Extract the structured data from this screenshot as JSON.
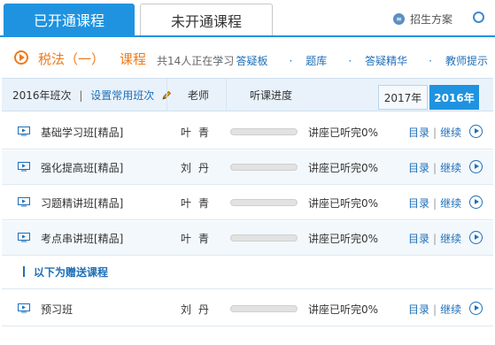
{
  "tabs": {
    "active": "已开通课程",
    "inactive": "未开通课程"
  },
  "top_right": {
    "recruit_label": "招生方案"
  },
  "course": {
    "name": "税法（一）",
    "word": "课程",
    "learners": "共14人正在学习"
  },
  "quick_links": [
    "答疑板",
    "题库",
    "答疑精华",
    "教师提示"
  ],
  "table_header": {
    "class_label": "2016年班次",
    "set_common": "设置常用班次",
    "teacher": "老师",
    "progress": "听课进度",
    "years": [
      "2017年",
      "2016年"
    ],
    "selected_year": "2016年"
  },
  "rows": [
    {
      "name": "基础学习班[精品]",
      "teacher": "叶青",
      "progress": 0,
      "status": "讲座已听完0%",
      "catalog": "目录",
      "continue": "继续"
    },
    {
      "name": "强化提高班[精品]",
      "teacher": "刘丹",
      "progress": 0,
      "status": "讲座已听完0%",
      "catalog": "目录",
      "continue": "继续"
    },
    {
      "name": "习题精讲班[精品]",
      "teacher": "叶青",
      "progress": 0,
      "status": "讲座已听完0%",
      "catalog": "目录",
      "continue": "继续"
    },
    {
      "name": "考点串讲班[精品]",
      "teacher": "叶青",
      "progress": 0,
      "status": "讲座已听完0%",
      "catalog": "目录",
      "continue": "继续"
    }
  ],
  "gift_heading": "以下为赠送课程",
  "gift_rows": [
    {
      "name": "预习班",
      "teacher": "刘丹",
      "progress": 0,
      "status": "讲座已听完0%",
      "catalog": "目录",
      "continue": "继续"
    }
  ],
  "colors": {
    "accent": "#1f93e0",
    "orange": "#ef7a1a",
    "link": "#1f6fb8"
  }
}
